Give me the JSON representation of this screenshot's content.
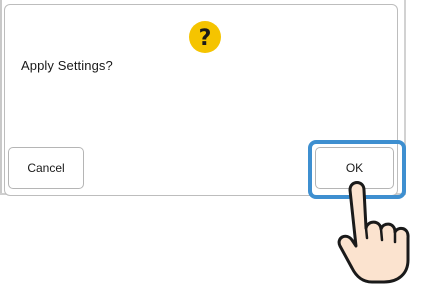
{
  "dialog": {
    "message": "Apply Settings?",
    "icon": "question-icon",
    "cancel_label": "Cancel",
    "ok_label": "OK"
  },
  "icons": {
    "hand": "pointing-hand-icon"
  },
  "colors": {
    "question_icon": "#f5c400",
    "highlight": "#3e8fd0",
    "hand_fill": "#fbe3cf"
  }
}
